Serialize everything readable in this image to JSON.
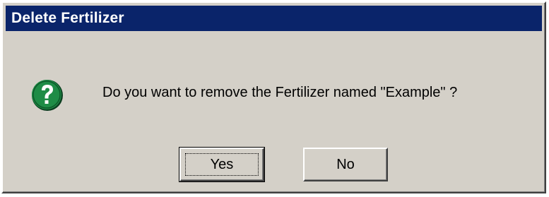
{
  "window": {
    "title": "Delete Fertilizer"
  },
  "dialog": {
    "icon": "question-icon",
    "message": "Do you want to remove the Fertilizer named \"Example\" ?",
    "buttons": {
      "yes_label": "Yes",
      "no_label": "No"
    }
  },
  "colors": {
    "titlebar": "#0a246a",
    "face": "#d4d0c8",
    "icon_fill": "#1e8c46"
  }
}
